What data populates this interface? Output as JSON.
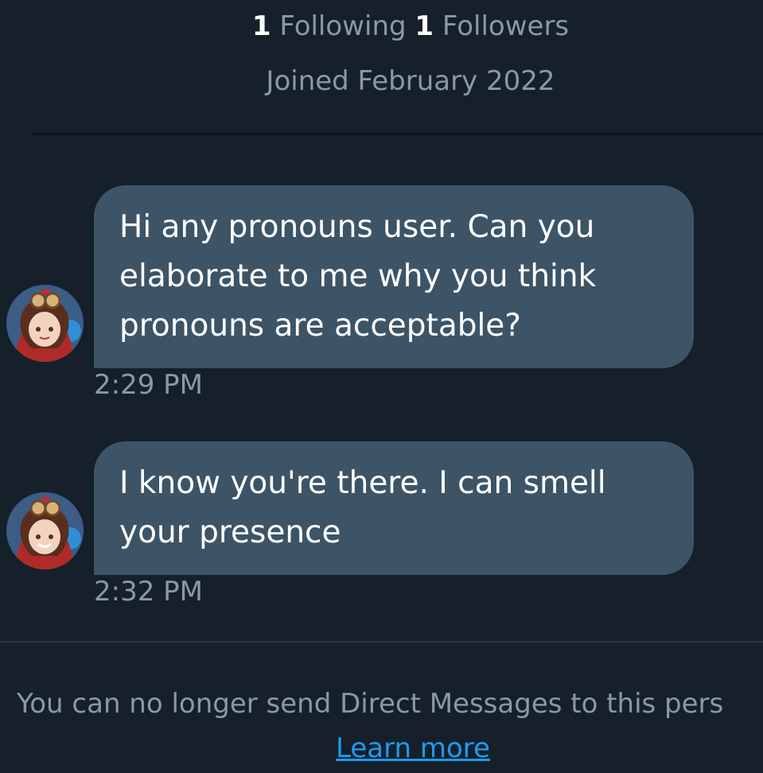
{
  "profile": {
    "following_count": "1",
    "following_label": "Following",
    "followers_count": "1",
    "followers_label": "Followers",
    "joined": "Joined February 2022"
  },
  "messages": [
    {
      "lines": [
        "Hi any pronouns user. Can you",
        "elaborate to me why you think",
        "pronouns are acceptable?"
      ],
      "time": "2:29 PM"
    },
    {
      "lines": [
        "I know you're there. I can smell",
        "your presence"
      ],
      "time": "2:32 PM"
    }
  ],
  "footer": {
    "notice": "You can no longer send Direct Messages to this pers",
    "link": "Learn more"
  },
  "colors": {
    "background": "#15202b",
    "bubble": "#3d5466",
    "muted_text": "#8b98a5",
    "link": "#1d9bf0"
  }
}
